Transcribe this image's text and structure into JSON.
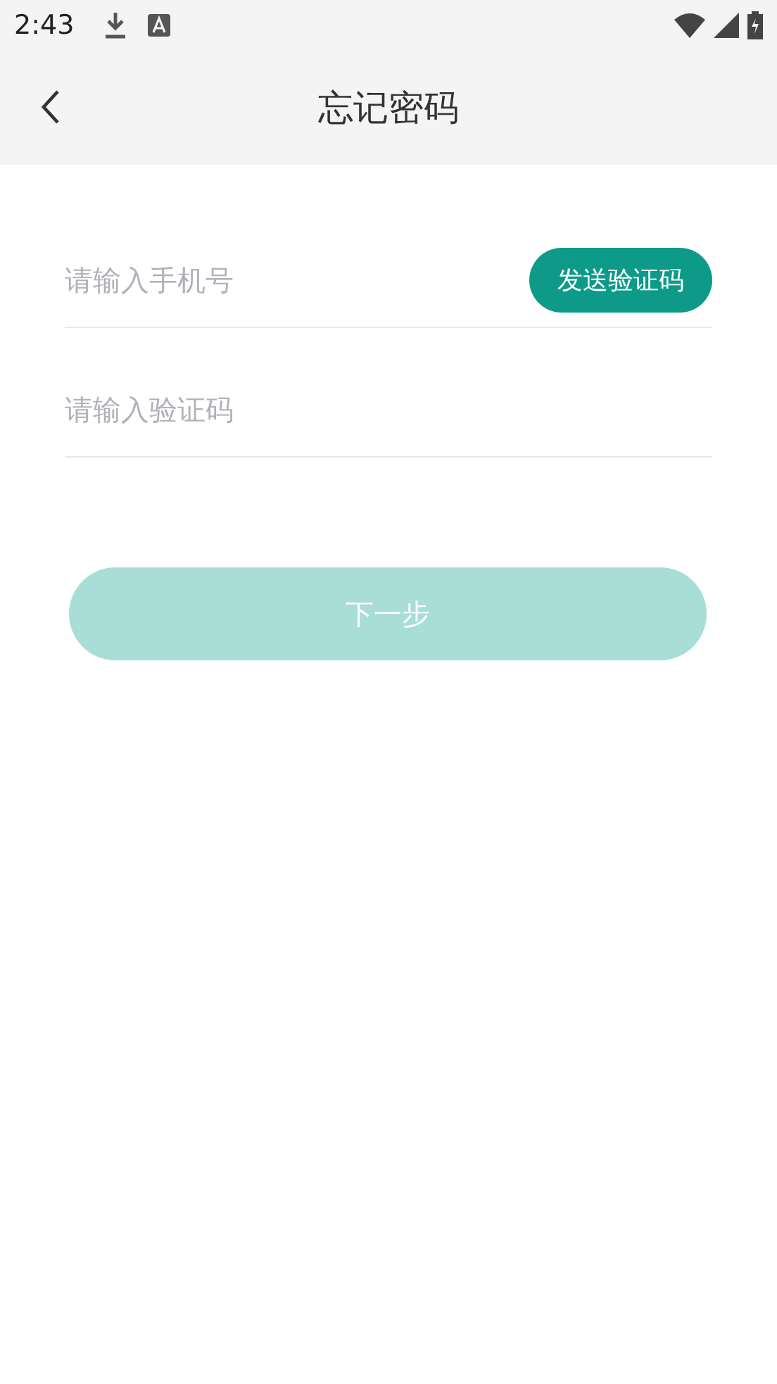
{
  "status_bar": {
    "time": "2:43"
  },
  "header": {
    "title": "忘记密码"
  },
  "phone_field": {
    "placeholder": "请输入手机号"
  },
  "send_code_button": {
    "label": "发送验证码"
  },
  "code_field": {
    "placeholder": "请输入验证码"
  },
  "next_button": {
    "label": "下一步",
    "disabled": true
  }
}
